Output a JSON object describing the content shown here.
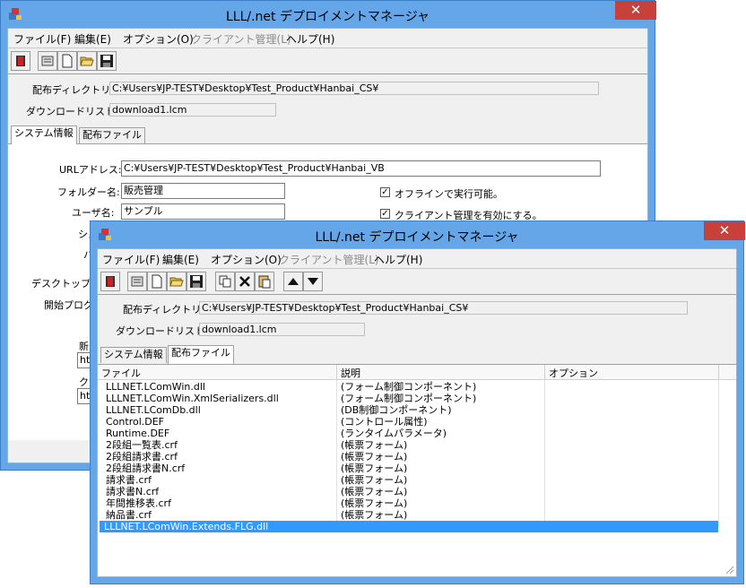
{
  "back_window": {
    "title": "LLL/.net デプロイメントマネージャ",
    "close_glyph": "✕",
    "menu": [
      "ファイル(F)",
      "編集(E)",
      "オプション(O)",
      "クライアント管理(L)",
      "ヘルプ(H)"
    ],
    "dist_dir_label": "配布ディレクトリ:",
    "dist_dir_value": "C:¥Users¥JP-TEST¥Desktop¥Test_Product¥Hanbai_CS¥",
    "download_list_label": "ダウンロードリスト:",
    "download_list_value": "download1.lcm",
    "tabs": [
      "システム情報",
      "配布ファイル"
    ],
    "url_label": "URLアドレス:",
    "url_value": "C:¥Users¥JP-TEST¥Desktop¥Test_Product¥Hanbai_VB",
    "folder_label": "フォルダー名:",
    "folder_value": "販売管理",
    "user_label": "ユーザ名:",
    "user_value": "サンプル",
    "offline_label": "オフラインで実行可能。",
    "client_mgmt_label": "クライアント管理を有効にする。",
    "system_label_partial": "システ",
    "version_label_partial": "バージ",
    "desktop_label_partial": "デスクトップア",
    "start_label_partial": "開始プログ",
    "new_label_partial": "新",
    "url_frag": "htt",
    "client_label_partial": "ク"
  },
  "front_window": {
    "title": "LLL/.net デプロイメントマネージャ",
    "close_glyph": "✕",
    "menu": [
      "ファイル(F)",
      "編集(E)",
      "オプション(O)",
      "クライアント管理(L)",
      "ヘルプ(H)"
    ],
    "dist_dir_label": "配布ディレクトリ:",
    "dist_dir_value": "C:¥Users¥JP-TEST¥Desktop¥Test_Product¥Hanbai_CS¥",
    "download_list_label": "ダウンロードリスト:",
    "download_list_value": "download1.lcm",
    "tabs": [
      "システム情報",
      "配布ファイル"
    ],
    "columns": [
      "ファイル",
      "説明",
      "オプション"
    ],
    "rows": [
      {
        "file": "LLLNET.LComWin.dll",
        "desc": "(フォーム制御コンポーネント)"
      },
      {
        "file": "LLLNET.LComWin.XmlSerializers.dll",
        "desc": "(フォーム制御コンポーネント)"
      },
      {
        "file": "LLLNET.LComDb.dll",
        "desc": "(DB制御コンポーネント)"
      },
      {
        "file": "Control.DEF",
        "desc": "(コントロール属性)"
      },
      {
        "file": "Runtime.DEF",
        "desc": "(ランタイムパラメータ)"
      },
      {
        "file": "2段組一覧表.crf",
        "desc": "(帳票フォーム)"
      },
      {
        "file": "2段組請求書.crf",
        "desc": "(帳票フォーム)"
      },
      {
        "file": "2段組請求書N.crf",
        "desc": "(帳票フォーム)"
      },
      {
        "file": "請求書.crf",
        "desc": "(帳票フォーム)"
      },
      {
        "file": "請求書N.crf",
        "desc": "(帳票フォーム)"
      },
      {
        "file": "年間推移表.crf",
        "desc": "(帳票フォーム)"
      },
      {
        "file": "納品書.crf",
        "desc": "(帳票フォーム)"
      },
      {
        "file": "LLLNET.LComWin.Extends.FLG.dll",
        "desc": ""
      }
    ]
  },
  "colors": {
    "titlebar": "#65a6e8",
    "close": "#c7403a",
    "selection": "#3399ff"
  }
}
